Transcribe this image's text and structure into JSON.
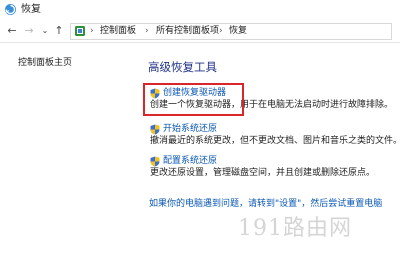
{
  "window": {
    "title": "恢复",
    "app_icon": "recovery-shield-icon"
  },
  "nav": {
    "back_icon": "arrow-left-icon",
    "forward_icon": "arrow-right-icon",
    "recent_icon": "chevron-down-icon",
    "up_icon": "arrow-up-icon"
  },
  "breadcrumb": {
    "items": [
      "控制面板",
      "所有控制面板项",
      "恢复"
    ],
    "icon": "control-panel-icon"
  },
  "sidebar": {
    "home_link": "控制面板主页"
  },
  "main": {
    "section_title": "高级恢复工具",
    "tools": [
      {
        "label": "创建恢复驱动器",
        "desc": "创建一个恢复驱动器，用于在电脑无法启动时进行故障排除。",
        "icon": "uac-shield-icon"
      },
      {
        "label": "开始系统还原",
        "desc": "撤消最近的系统更改，但不更改文档、图片和音乐之类的文件。",
        "icon": "uac-shield-icon"
      },
      {
        "label": "配置系统还原",
        "desc": "更改还原设置，管理磁盘空间，并且创建或删除还原点。",
        "icon": "uac-shield-icon"
      }
    ],
    "bottom_link": "如果你的电脑遇到问题，请转到\"设置\"，然后尝试重置电脑"
  },
  "watermark": "191路由网",
  "colors": {
    "link": "#0a57b3",
    "section_title": "#1e3287",
    "highlight": "#d9262a"
  }
}
